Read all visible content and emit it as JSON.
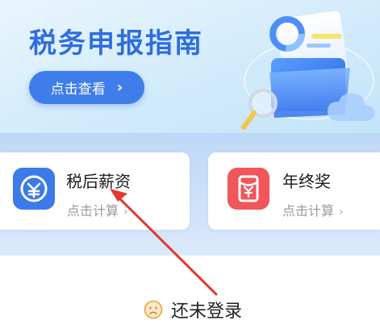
{
  "banner": {
    "title": "税务申报指南",
    "button_label": "点击查看",
    "button_chevron": "›"
  },
  "cards": [
    {
      "title": "税后薪资",
      "subtitle": "点击计算",
      "chevron": "›",
      "icon": "yuan-coin-icon",
      "color": "#3b7ae8"
    },
    {
      "title": "年终奖",
      "subtitle": "点击计算",
      "chevron": "›",
      "icon": "red-envelope-icon",
      "color": "#f0565a"
    }
  ],
  "login": {
    "status_text": "还未登录",
    "icon": "sad-face-icon"
  },
  "annotation": {
    "arrow_color": "#e23a2e"
  }
}
